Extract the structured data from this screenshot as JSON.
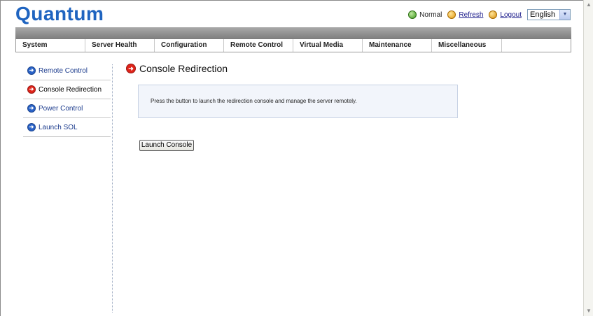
{
  "header": {
    "logo": "Quantum",
    "status_label": "Normal",
    "refresh_label": "Refresh",
    "logout_label": "Logout",
    "language": "English"
  },
  "nav": {
    "tabs": [
      {
        "label": "System"
      },
      {
        "label": "Server Health"
      },
      {
        "label": "Configuration"
      },
      {
        "label": "Remote Control"
      },
      {
        "label": "Virtual Media"
      },
      {
        "label": "Maintenance"
      },
      {
        "label": "Miscellaneous"
      }
    ]
  },
  "sidebar": {
    "items": [
      {
        "label": "Remote Control",
        "active": false
      },
      {
        "label": "Console Redirection",
        "active": true
      },
      {
        "label": "Power Control",
        "active": false
      },
      {
        "label": "Launch SOL",
        "active": false
      }
    ]
  },
  "main": {
    "title": "Console Redirection",
    "info_text": "Press the button to launch the redirection console and manage the server remotely.",
    "launch_button_label": "Launch Console"
  },
  "colors": {
    "logo": "#1f64c0",
    "active_arrow": "#e0241a",
    "inactive_arrow": "#2a63c8"
  }
}
